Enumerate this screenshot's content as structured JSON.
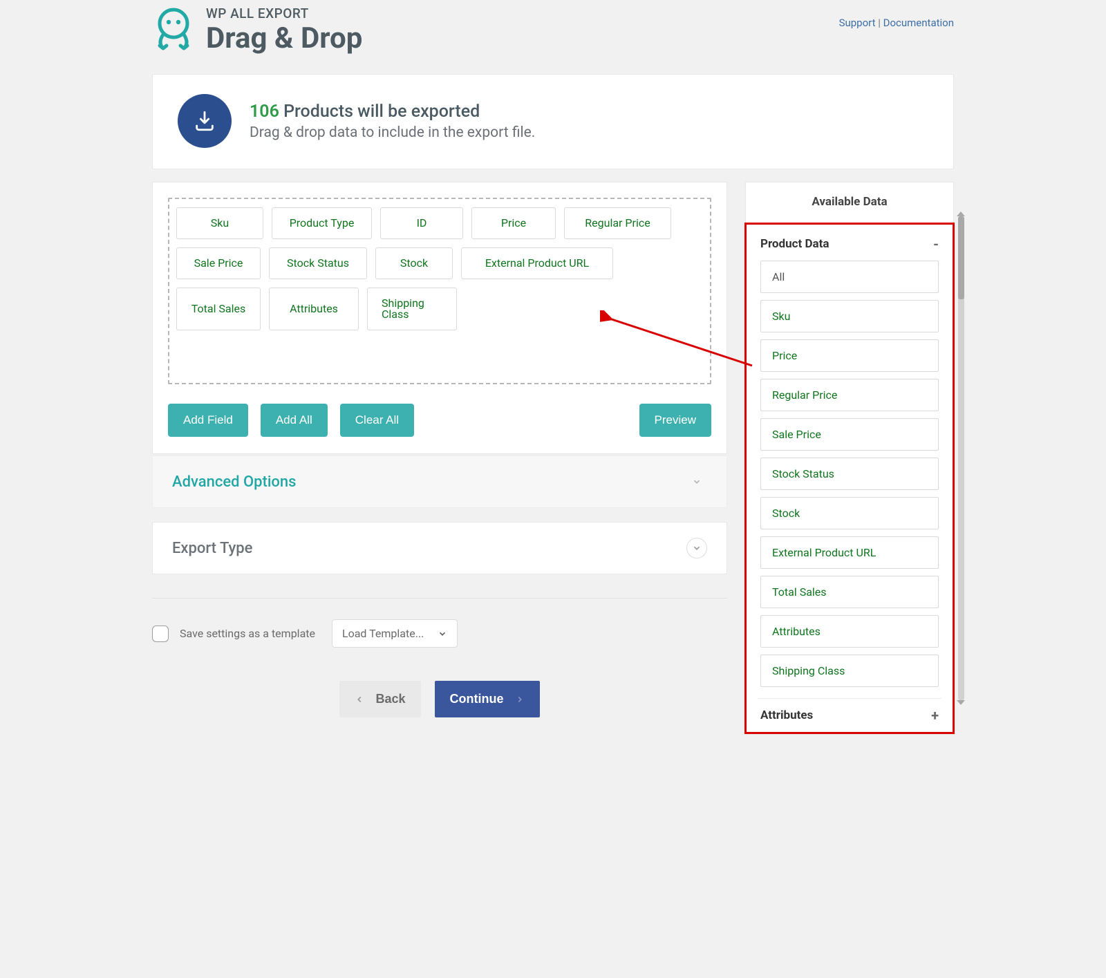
{
  "brand": {
    "small": "WP ALL EXPORT",
    "big": "Drag & Drop"
  },
  "header_links": {
    "support": "Support",
    "documentation": "Documentation"
  },
  "summary": {
    "count": "106",
    "title_suffix": " Products will be exported",
    "subtitle": "Drag & drop data to include in the export file."
  },
  "chips": [
    "Sku",
    "Product Type",
    "ID",
    "Price",
    "Regular Price",
    "Sale Price",
    "Stock Status",
    "Stock",
    "External Product URL",
    "Total Sales",
    "Attributes",
    "Shipping Class"
  ],
  "buttons": {
    "add_field": "Add Field",
    "add_all": "Add All",
    "clear_all": "Clear All",
    "preview": "Preview"
  },
  "sections": {
    "advanced": "Advanced Options",
    "export_type": "Export Type"
  },
  "save_template": {
    "checkbox_label": "Save settings as a template",
    "select_label": "Load Template..."
  },
  "nav": {
    "back": "Back",
    "continue": "Continue"
  },
  "sidebar": {
    "title": "Available Data",
    "group_open": {
      "title": "Product Data",
      "toggle": "-"
    },
    "items": [
      "All",
      "Sku",
      "Price",
      "Regular Price",
      "Sale Price",
      "Stock Status",
      "Stock",
      "External Product URL",
      "Total Sales",
      "Attributes",
      "Shipping Class"
    ],
    "group_closed": {
      "title": "Attributes",
      "toggle": "+"
    }
  }
}
